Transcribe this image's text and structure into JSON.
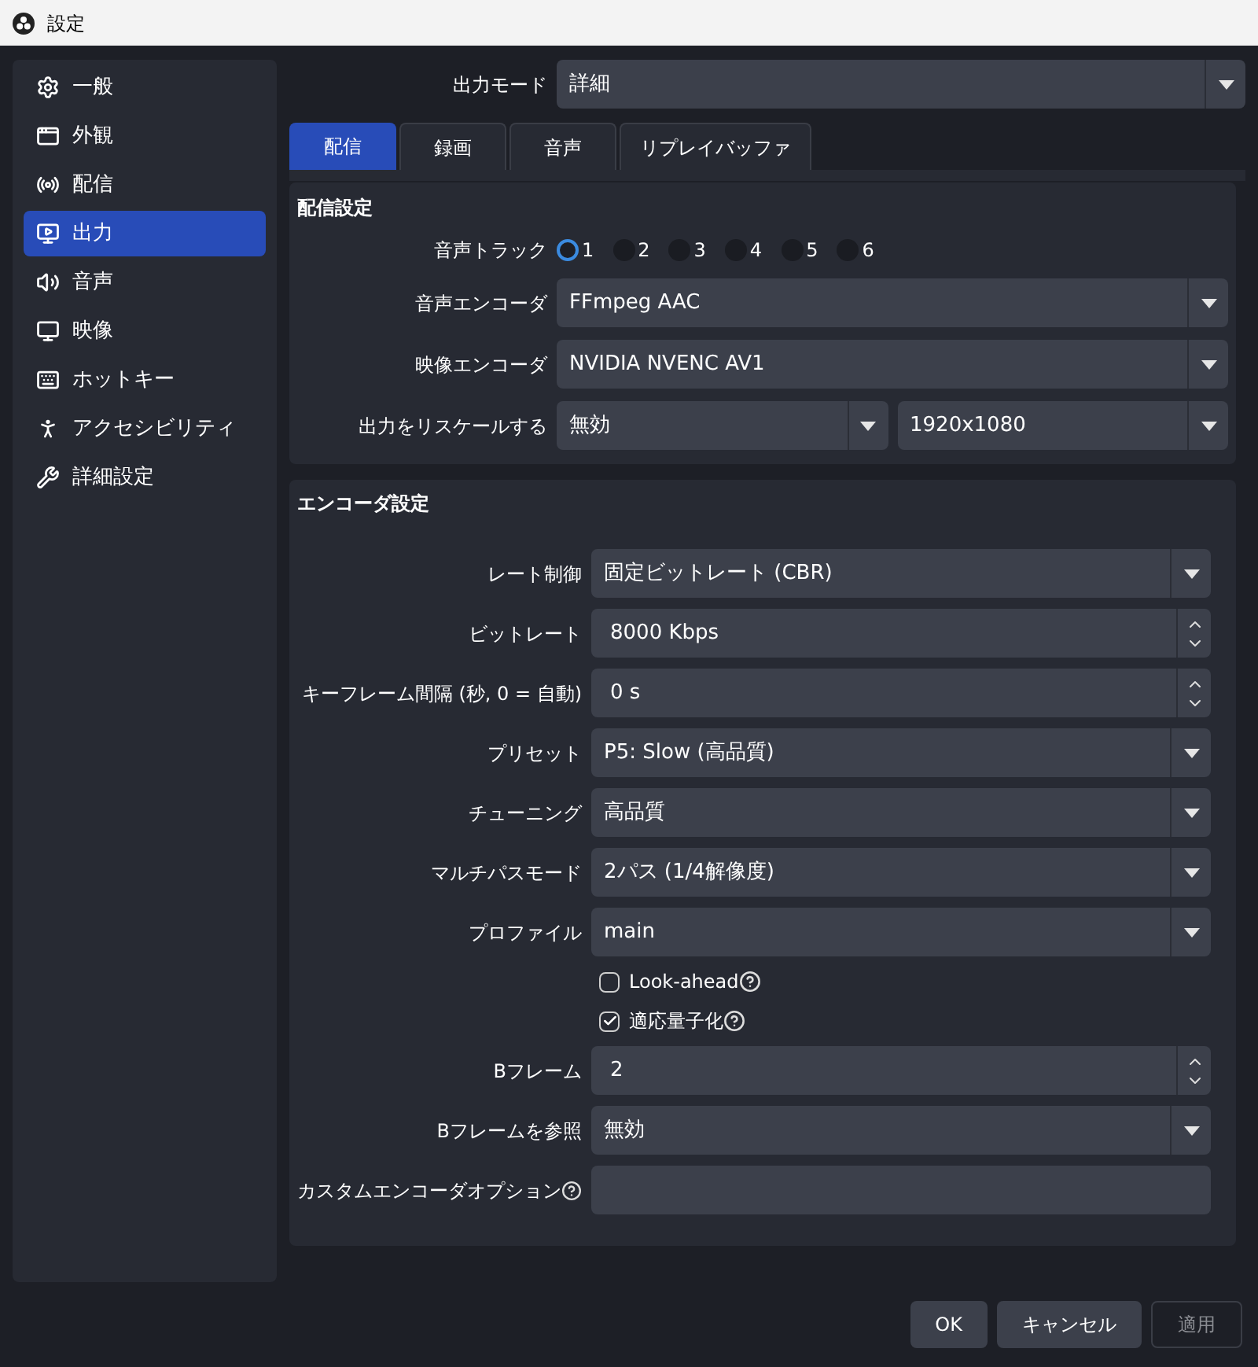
{
  "window": {
    "title": "設定"
  },
  "sidebar": {
    "items": [
      {
        "label": "一般",
        "selected": false
      },
      {
        "label": "外観",
        "selected": false
      },
      {
        "label": "配信",
        "selected": false
      },
      {
        "label": "出力",
        "selected": true
      },
      {
        "label": "音声",
        "selected": false
      },
      {
        "label": "映像",
        "selected": false
      },
      {
        "label": "ホットキー",
        "selected": false
      },
      {
        "label": "アクセシビリティ",
        "selected": false
      },
      {
        "label": "詳細設定",
        "selected": false
      }
    ]
  },
  "output_mode": {
    "label": "出力モード",
    "value": "詳細"
  },
  "tabs": [
    {
      "label": "配信",
      "selected": true
    },
    {
      "label": "録画",
      "selected": false
    },
    {
      "label": "音声",
      "selected": false
    },
    {
      "label": "リプレイバッファ",
      "selected": false
    }
  ],
  "stream_section": {
    "title": "配信設定",
    "audio_track": {
      "label": "音声トラック",
      "options": [
        {
          "label": "1",
          "selected": true
        },
        {
          "label": "2",
          "selected": false
        },
        {
          "label": "3",
          "selected": false
        },
        {
          "label": "4",
          "selected": false
        },
        {
          "label": "5",
          "selected": false
        },
        {
          "label": "6",
          "selected": false
        }
      ]
    },
    "fields": [
      {
        "label": "音声エンコーダ",
        "values": [
          "FFmpeg AAC"
        ]
      },
      {
        "label": "映像エンコーダ",
        "values": [
          "NVIDIA NVENC AV1"
        ]
      },
      {
        "label": "出力をリスケールする",
        "values": [
          "無効",
          "1920x1080"
        ]
      }
    ]
  },
  "encoder_section": {
    "title": "エンコーダ設定",
    "rows": [
      {
        "kind": "select",
        "label": "レート制御",
        "value": "固定ビットレート (CBR)",
        "help": false
      },
      {
        "kind": "spin",
        "label": "ビットレート",
        "value": "8000 Kbps",
        "help": false
      },
      {
        "kind": "spin",
        "label": "キーフレーム間隔 (秒, 0 = 自動)",
        "value": "0 s",
        "help": false
      },
      {
        "kind": "select",
        "label": "プリセット",
        "value": "P5: Slow (高品質)",
        "help": false
      },
      {
        "kind": "select",
        "label": "チューニング",
        "value": "高品質",
        "help": false
      },
      {
        "kind": "select",
        "label": "マルチパスモード",
        "value": "2パス (1/4解像度)",
        "help": false
      },
      {
        "kind": "select",
        "label": "プロファイル",
        "value": "main",
        "help": false
      },
      {
        "kind": "checkbox",
        "label": "Look-ahead",
        "checked": false,
        "help": true
      },
      {
        "kind": "checkbox",
        "label": "適応量子化",
        "checked": true,
        "help": true
      },
      {
        "kind": "spin",
        "label": "Bフレーム",
        "value": "2",
        "help": false
      },
      {
        "kind": "select",
        "label": "Bフレームを参照",
        "value": "無効",
        "help": false
      },
      {
        "kind": "text",
        "label": "カスタムエンコーダオプション",
        "help": true
      }
    ]
  },
  "buttons": [
    {
      "label": "OK",
      "disabled": false
    },
    {
      "label": "キャンセル",
      "disabled": false
    },
    {
      "label": "適用",
      "disabled": true
    }
  ]
}
